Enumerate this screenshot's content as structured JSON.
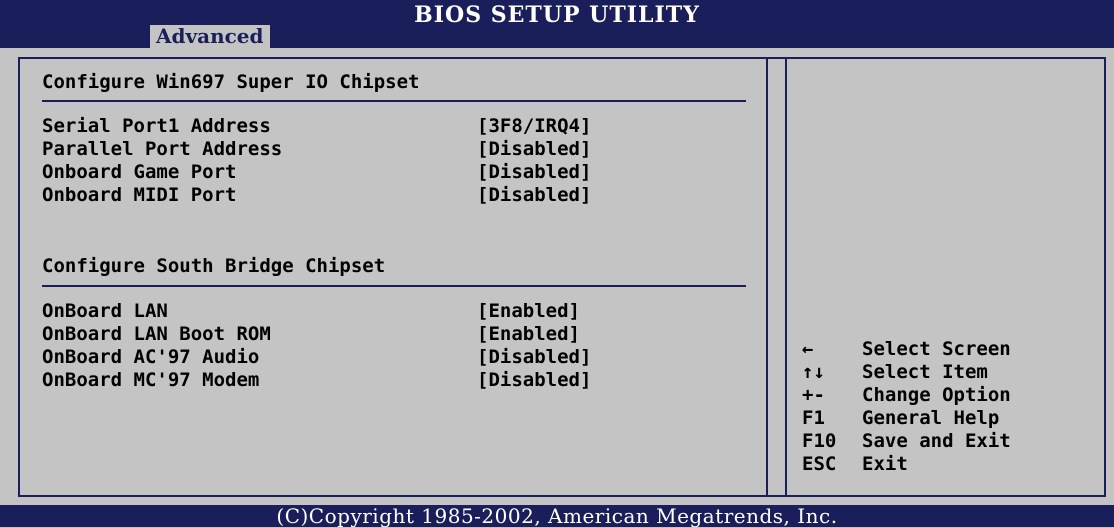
{
  "header": {
    "title": "BIOS SETUP UTILITY",
    "active_tab": "Advanced"
  },
  "main": {
    "section1_title": "Configure Win697 Super IO Chipset",
    "section1_items": [
      {
        "label": "Serial Port1 Address",
        "value": "[3F8/IRQ4]"
      },
      {
        "label": "Parallel Port Address",
        "value": "[Disabled]"
      },
      {
        "label": "Onboard Game Port",
        "value": "[Disabled]"
      },
      {
        "label": "Onboard MIDI Port",
        "value": "[Disabled]"
      }
    ],
    "section2_title": "Configure South Bridge Chipset",
    "section2_items": [
      {
        "label": "OnBoard LAN",
        "value": "[Enabled]"
      },
      {
        "label": "OnBoard LAN Boot ROM",
        "value": "[Enabled]"
      },
      {
        "label": "OnBoard AC'97 Audio",
        "value": "[Disabled]"
      },
      {
        "label": "OnBoard MC'97 Modem",
        "value": "[Disabled]"
      }
    ]
  },
  "help": [
    {
      "key": "←",
      "text": "Select Screen",
      "icon": "left-arrow-icon"
    },
    {
      "key": "↑↓",
      "text": "Select Item",
      "icon": "up-down-arrow-icon"
    },
    {
      "key": "+-",
      "text": "Change Option"
    },
    {
      "key": "F1",
      "text": "General Help"
    },
    {
      "key": "F10",
      "text": "Save and Exit"
    },
    {
      "key": "ESC",
      "text": "Exit"
    }
  ],
  "footer": {
    "copyright": "(C)Copyright 1985-2002, American Megatrends, Inc."
  },
  "colors": {
    "background": "#c4c4c4",
    "header_blue": "#1a1f5c",
    "text": "#000000",
    "footer_text": "#ffffff"
  }
}
